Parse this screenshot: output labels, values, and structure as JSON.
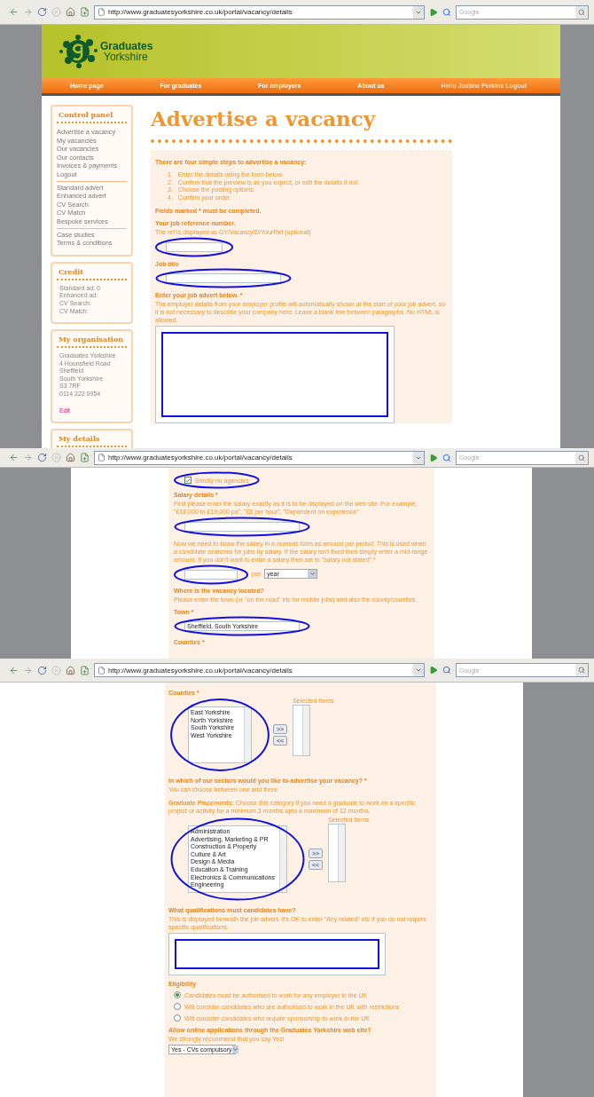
{
  "windows": [
    {
      "kind": "top",
      "url": "http://www.graduatesyorkshire.co.uk/portal/vacancy/details",
      "search": {
        "placeholder": "Google"
      },
      "logo": {
        "line1": "Graduates",
        "line2": "Yorkshire"
      },
      "nav": [
        "Home page",
        "For graduates",
        "For employers",
        "About us"
      ],
      "greeting": "Hello Justine Perkins Logout",
      "sidebar": [
        {
          "kind": "links",
          "title": "Control panel",
          "groups": [
            [
              "Advertise a vacancy",
              "My vacancies",
              "Our vacancies",
              "Our contacts",
              "Invoices & payments",
              "Logout"
            ],
            [
              "Standard advert",
              "Enhanced advert",
              "CV Search",
              "CV Match",
              "Bespoke services"
            ],
            [
              "Case studies",
              "Terms & conditions"
            ]
          ]
        },
        {
          "kind": "lines",
          "title": "Credit",
          "lines": [
            "Standard ad: 0",
            "Enhanced ad:",
            "CV Search:",
            "CV Match:"
          ]
        },
        {
          "kind": "lines",
          "title": "My organisation",
          "lines": [
            "Graduates Yorkshire",
            "4 Hounsfield Road",
            "Sheffield",
            "South Yorkshire",
            "S3 7RF",
            "0114 222 0954"
          ],
          "link": "Edit"
        },
        {
          "kind": "lines",
          "title": "My details"
        }
      ],
      "title": "Advertise a vacancy",
      "intro": {
        "heading": "There are four simple steps to advertise a vacancy:",
        "steps": [
          {
            "number": "1.",
            "text": "Enter the details using the form below."
          },
          {
            "number": "2.",
            "text": "Confirm that the preview is as you expect, or edit the details if not."
          },
          {
            "number": "3.",
            "text": "Choose the posting options."
          },
          {
            "number": "4.",
            "text": "Confirm your order."
          }
        ],
        "note": "Fields marked * must be completed."
      },
      "fields": [
        {
          "kind": "short_text",
          "label": "Your job reference number.",
          "hint": "The ref is displayed as GY/VacancyID/YourRef (optional)",
          "circled": true
        },
        {
          "kind": "text",
          "label": "Job title",
          "circled": true
        },
        {
          "kind": "textarea",
          "label": "Enter your job advert below. *",
          "hint": "The employer details from your employer profile will automatically shown at the start of your job advert, so it is not necessary to describe your company here. Leave a blank line between paragraphs. No HTML is allowed.",
          "boxed": true
        }
      ]
    },
    {
      "kind": "middle",
      "url": "http://www.graduatesyorkshire.co.uk/portal/vacancy/details",
      "search": {
        "placeholder": "Google"
      },
      "fields": [
        {
          "kind": "checkbox",
          "label": "Strictly no agencies",
          "checked": true,
          "circled": true
        },
        {
          "kind": "text",
          "label": "Salary details *",
          "hint": "First please enter the salary exactly as it is to be displayed on the web site. For example, \"£18,000 to £19,000 pa\", \"£8 per hour\", \"Dependent on experience\"",
          "circled": true
        },
        {
          "kind": "amount",
          "hint": "Now we need to know the salary in a numeric form as amount per period. This is used when a candidate searches for jobs by salary. If the salary isn't fixed then simply enter a mid-range amount. If you don't want to enter a salary then set to \"salary not stated\".*",
          "per": "per",
          "period": "year",
          "circled": true
        },
        {
          "kind": "note",
          "label": "Where is the vacancy located?",
          "hint": "Please enter the town (or \"on the road\" etc for mobile jobs) and also the county/counties."
        },
        {
          "kind": "text",
          "label": "Town *",
          "value": "Sheffield, South Yorkshire",
          "circled": true
        },
        {
          "kind": "note",
          "label": "Counties *"
        }
      ]
    },
    {
      "kind": "bottom",
      "url": "http://www.graduatesyorkshire.co.uk/portal/vacancy/details",
      "search": {
        "placeholder": "Google"
      },
      "fields": [
        {
          "kind": "listpair",
          "label": "Counties *",
          "options": [
            "East Yorkshire",
            "North Yorkshire",
            "South Yorkshire",
            "West Yorkshire"
          ],
          "selected_label": "Selected Items",
          "add": ">>",
          "remove": "<<",
          "circled": true
        },
        {
          "kind": "note",
          "label": "In which of our sectors would you like to advertise your vacancy? *",
          "hint": "You can choose between one and three"
        },
        {
          "kind": "listpair",
          "description": "**Graduate Placements:** Choose this category if you need a graduate to work on a specific project or activity for a minimum 3 months upto a maximum of 12 months.",
          "options": [
            "Administration",
            "Advertising, Marketing & PR",
            "Construction & Property",
            "Culture & Art",
            "Design & Media",
            "Education & Training",
            "Electronics & Communications",
            "Engineering"
          ],
          "selected_label": "Selected Items",
          "add": ">>",
          "remove": "<<",
          "circled": true
        },
        {
          "kind": "textarea",
          "label": "What qualifications must candidates have?",
          "hint": "This is displayed beneath the job advert. It's OK to enter \"Any related\" etc if you do not require specific qualifications.",
          "boxed": true
        },
        {
          "kind": "radio_group",
          "label": "Eligibility",
          "options": [
            {
              "label": "Candidates must be authorised to work for any employer in the UK",
              "selected": true
            },
            {
              "label": "Will consider candidates who are authorised to work in the UK with restrictions",
              "selected": false
            },
            {
              "label": "Will consider candidates who require sponsorship to work in the UK",
              "selected": false
            }
          ]
        },
        {
          "kind": "select",
          "label": "Allow online applications through the Graduates Yorkshire web site?",
          "hint": "We strongly recommend that you say Yes!",
          "value": "Yes - CVs compulsory"
        }
      ]
    }
  ]
}
